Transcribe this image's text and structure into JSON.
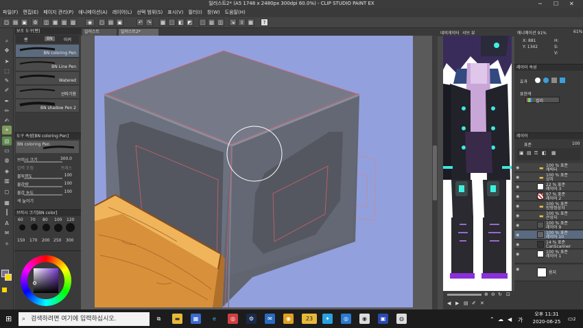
{
  "window": {
    "title": "일러스트2* (A5 1748 x 2480px 300dpi 60.0%) - CLIP STUDIO PAINT EX"
  },
  "menu": [
    "파일(F)",
    "편집(E)",
    "페이지 관리(P)",
    "애니메이션(A)",
    "레이어(L)",
    "선택 범위(S)",
    "표시(V)",
    "필터(I)",
    "창(W)",
    "도움말(H)"
  ],
  "doc_tabs": [
    "일러스트",
    "일러스트2*"
  ],
  "sub_tool": {
    "header": "보조 도구[펜]",
    "tabs": [
      "펜",
      "BN",
      "마커"
    ],
    "brushes": [
      "BN coloring Pen",
      "BN Line Pen",
      "Watered",
      "선따기용",
      "BN shadow Pen 2"
    ]
  },
  "tool_property": {
    "header": "도구 속성[BN coloring Pen]",
    "brush_name": "BN coloring Pen",
    "rows": [
      {
        "label": "브러시 크기",
        "value": "300.0"
      },
      {
        "label": "압력 조정",
        "value": "프레스"
      },
      {
        "label": "불투명도",
        "value": "100"
      },
      {
        "label": "물감량",
        "value": "100"
      },
      {
        "label": "물감 농도",
        "value": "100"
      },
      {
        "label": "색 늘이기",
        "value": ""
      }
    ]
  },
  "brush_size": {
    "header": "브러시 크기[BN color]",
    "row1": [
      "60",
      "70",
      "80",
      "100",
      "120"
    ],
    "row2": [
      "150",
      "170",
      "200",
      "250",
      "300"
    ]
  },
  "color": {
    "main": "#7a6b8a",
    "sub": "#ffd700"
  },
  "navigator": {
    "header": "네비게이터",
    "tabs": [
      "서브 뷰"
    ]
  },
  "info": {
    "lines": [
      "X: 881",
      "Y: 1342"
    ],
    "header": "애니메이션 91%",
    "zoom": "61%",
    "hsb": [
      "H:",
      "S:",
      "V:"
    ]
  },
  "layer_property": {
    "header": "레이어 속성",
    "effect_label": "효과",
    "expression_label": "표현색",
    "expression_value": "컬러"
  },
  "layers": {
    "header": "레이어",
    "blend": "표준",
    "opacity": "100",
    "items": [
      {
        "pct": "100 % 표준",
        "name": "캐릭터"
      },
      {
        "pct": "100 % 표준",
        "name": "상자"
      },
      {
        "pct": "22 % 표준",
        "name": "레이어 3"
      },
      {
        "pct": "97 % 표준",
        "name": "레이어 2"
      },
      {
        "pct": "100 % 표준",
        "name": "방향정상자"
      },
      {
        "pct": "100 % 표준",
        "name": "큰상자"
      },
      {
        "pct": "100 % 표준",
        "name": "레이어 9"
      },
      {
        "pct": "100 % 표준",
        "name": "레이어 10"
      },
      {
        "pct": "14 % 표준",
        "name": "CanScanner"
      },
      {
        "pct": "100 % 표준",
        "name": "레이어 1"
      },
      {
        "pct": "",
        "name": "용지"
      }
    ]
  },
  "taskbar": {
    "search_placeholder": "검색하려면 여기에 입력하십시오.",
    "badge": "23",
    "time": "오후 11:31",
    "date": "2020-06-25",
    "notif": "2"
  }
}
